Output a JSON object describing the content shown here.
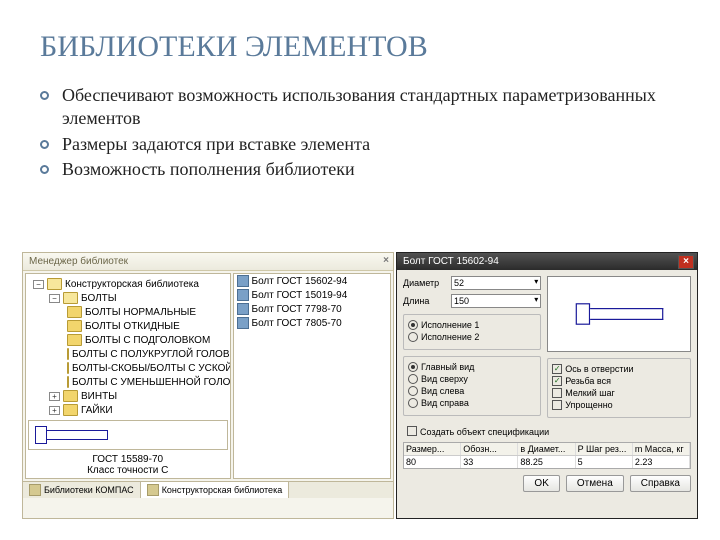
{
  "slide": {
    "title": "БИБЛИОТЕКИ ЭЛЕМЕНТОВ",
    "bullets": [
      "Обеспечивают возможность использования стандартных параметризованных элементов",
      "Размеры задаются  при вставке элемента",
      "Возможность пополнения библиотеки"
    ]
  },
  "libmgr": {
    "header": "Менеджер библиотек",
    "root": "Конструкторская библиотека",
    "group": "БОЛТЫ",
    "folders": [
      "БОЛТЫ НОРМАЛЬНЫЕ",
      "БОЛТЫ ОТКИДНЫЕ",
      "БОЛТЫ С ПОДГОЛОВКОМ",
      "БОЛТЫ С ПОЛУКРУГЛОЙ ГОЛОВКОЙ",
      "БОЛТЫ-СКОБЫ/БОЛТЫ С УСКОЙ",
      "БОЛТЫ С УМЕНЬШЕННОЙ ГОЛОВКОЙ"
    ],
    "siblings": [
      "ВИНТЫ",
      "ГАЙКИ"
    ],
    "list": [
      "Болт ГОСТ 15602-94",
      "Болт ГОСТ 15019-94",
      "Болт ГОСТ 7798-70",
      "Болт ГОСТ 7805-70"
    ],
    "preview_caption": "ГОСТ 15589-70",
    "preview_sub": "Класс точности С",
    "tabs": [
      "Библиотеки КОМПАС",
      "Конструкторская библиотека"
    ]
  },
  "dlg": {
    "title": "Болт  ГОСТ 15602-94",
    "fields": {
      "diameter_lbl": "Диаметр",
      "diameter_val": "52",
      "length_lbl": "Длина",
      "length_val": "150"
    },
    "exec": {
      "r1": "Исполнение 1",
      "r2": "Исполнение 2"
    },
    "viewgrp": {
      "r1": "Главный вид",
      "r2": "Вид сверху",
      "r3": "Вид слева",
      "r4": "Вид справа"
    },
    "opts": {
      "c1": "Ось в отверстии",
      "c2": "Резьба вся",
      "c3": "Мелкий шаг",
      "c4": "Упрощенно"
    },
    "create": "Создать объект спецификации",
    "table": {
      "headers": [
        "Размер...",
        "Обозн...",
        "в Диамет...",
        "P Шаг рез...",
        "m Масса, кг"
      ],
      "row": [
        "80",
        "33",
        "88.25",
        "5",
        "2.23"
      ]
    },
    "buttons": {
      "ok": "OK",
      "cancel": "Отмена",
      "help": "Справка"
    }
  }
}
